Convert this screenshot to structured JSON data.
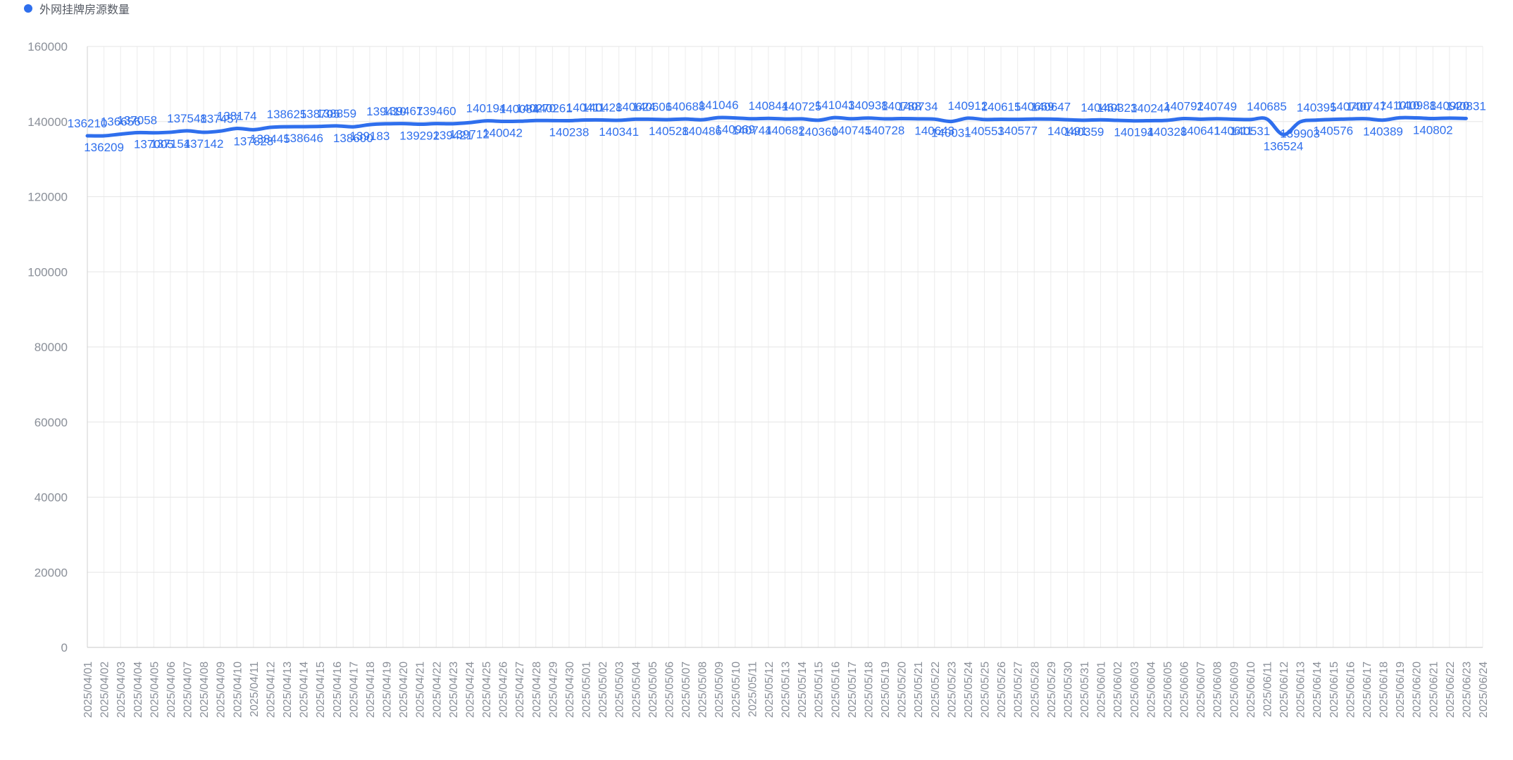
{
  "chart_data": {
    "type": "line",
    "title": "",
    "legend_position": "top-left",
    "grid": true,
    "xlabel": "",
    "ylabel": "",
    "ylim": [
      0,
      160000
    ],
    "yticks": [
      0,
      20000,
      40000,
      60000,
      80000,
      100000,
      120000,
      140000,
      160000
    ],
    "accent_color": "#2f6fed",
    "categories": [
      "2025/04/01",
      "2025/04/02",
      "2025/04/03",
      "2025/04/04",
      "2025/04/05",
      "2025/04/06",
      "2025/04/07",
      "2025/04/08",
      "2025/04/09",
      "2025/04/10",
      "2025/04/11",
      "2025/04/12",
      "2025/04/13",
      "2025/04/14",
      "2025/04/15",
      "2025/04/16",
      "2025/04/17",
      "2025/04/18",
      "2025/04/19",
      "2025/04/20",
      "2025/04/21",
      "2025/04/22",
      "2025/04/23",
      "2025/04/24",
      "2025/04/25",
      "2025/04/26",
      "2025/04/27",
      "2025/04/28",
      "2025/04/29",
      "2025/04/30",
      "2025/05/01",
      "2025/05/02",
      "2025/05/03",
      "2025/05/04",
      "2025/05/05",
      "2025/05/06",
      "2025/05/07",
      "2025/05/08",
      "2025/05/09",
      "2025/05/10",
      "2025/05/11",
      "2025/05/12",
      "2025/05/13",
      "2025/05/14",
      "2025/05/15",
      "2025/05/16",
      "2025/05/17",
      "2025/05/18",
      "2025/05/19",
      "2025/05/20",
      "2025/05/21",
      "2025/05/22",
      "2025/05/23",
      "2025/05/24",
      "2025/05/25",
      "2025/05/26",
      "2025/05/27",
      "2025/05/28",
      "2025/05/29",
      "2025/05/30",
      "2025/05/31",
      "2025/06/01",
      "2025/06/02",
      "2025/06/03",
      "2025/06/04",
      "2025/06/05",
      "2025/06/06",
      "2025/06/07",
      "2025/06/08",
      "2025/06/09",
      "2025/06/10",
      "2025/06/11",
      "2025/06/12",
      "2025/06/13",
      "2025/06/14",
      "2025/06/15",
      "2025/06/16",
      "2025/06/17",
      "2025/06/18",
      "2025/06/19",
      "2025/06/20",
      "2025/06/21",
      "2025/06/22",
      "2025/06/23",
      "2025/06/24"
    ],
    "series": [
      {
        "name": "外网挂牌房源数量",
        "color": "#2f6fed",
        "values": [
          136210,
          136209,
          136656,
          137058,
          137005,
          137154,
          137548,
          137142,
          137457,
          138174,
          137828,
          138445,
          138625,
          138646,
          138705,
          138859,
          138600,
          139183,
          139410,
          139467,
          139292,
          139460,
          139421,
          139712,
          140194,
          140042,
          140084,
          140270,
          140261,
          140238,
          140411,
          140428,
          140341,
          140624,
          140606,
          140528,
          140688,
          140486,
          141046,
          140969,
          140744,
          140844,
          140682,
          140725,
          140360,
          141043,
          140745,
          140938,
          140728,
          140788,
          140734,
          140643,
          140031,
          140912,
          140553,
          140615,
          140577,
          140669,
          140647,
          140491,
          140359,
          140464,
          140323,
          140194,
          140244,
          140328,
          140792,
          140641,
          140749,
          140611,
          140531,
          140685,
          136524,
          139903,
          140395,
          140576,
          140700,
          140747,
          140389,
          141010,
          140988,
          140802,
          140920,
          140831
        ]
      }
    ]
  }
}
